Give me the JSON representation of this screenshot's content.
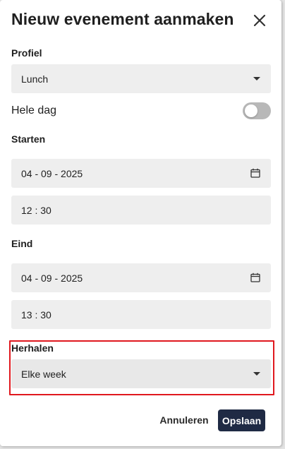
{
  "dialog": {
    "title": "Nieuw evenement aanmaken"
  },
  "profile": {
    "label": "Profiel",
    "value": "Lunch"
  },
  "all_day": {
    "label": "Hele dag",
    "enabled": false
  },
  "start": {
    "label": "Starten",
    "date": "04 - 09 - 2025",
    "time": "12 : 30"
  },
  "end": {
    "label": "Eind",
    "date": "04 - 09 - 2025",
    "time": "13 : 30"
  },
  "repeat": {
    "label": "Herhalen",
    "value": "Elke week"
  },
  "actions": {
    "cancel_label": "Annuleren",
    "save_label": "Opslaan"
  },
  "colors": {
    "save_button": "#1f2a44",
    "highlight_border": "#e0181e",
    "field_background": "#eeeeee",
    "toggle_off": "#b8b8b8"
  },
  "icons": {
    "close": "close-icon",
    "dropdown": "chevron-down-icon",
    "date_picker": "calendar-icon"
  }
}
